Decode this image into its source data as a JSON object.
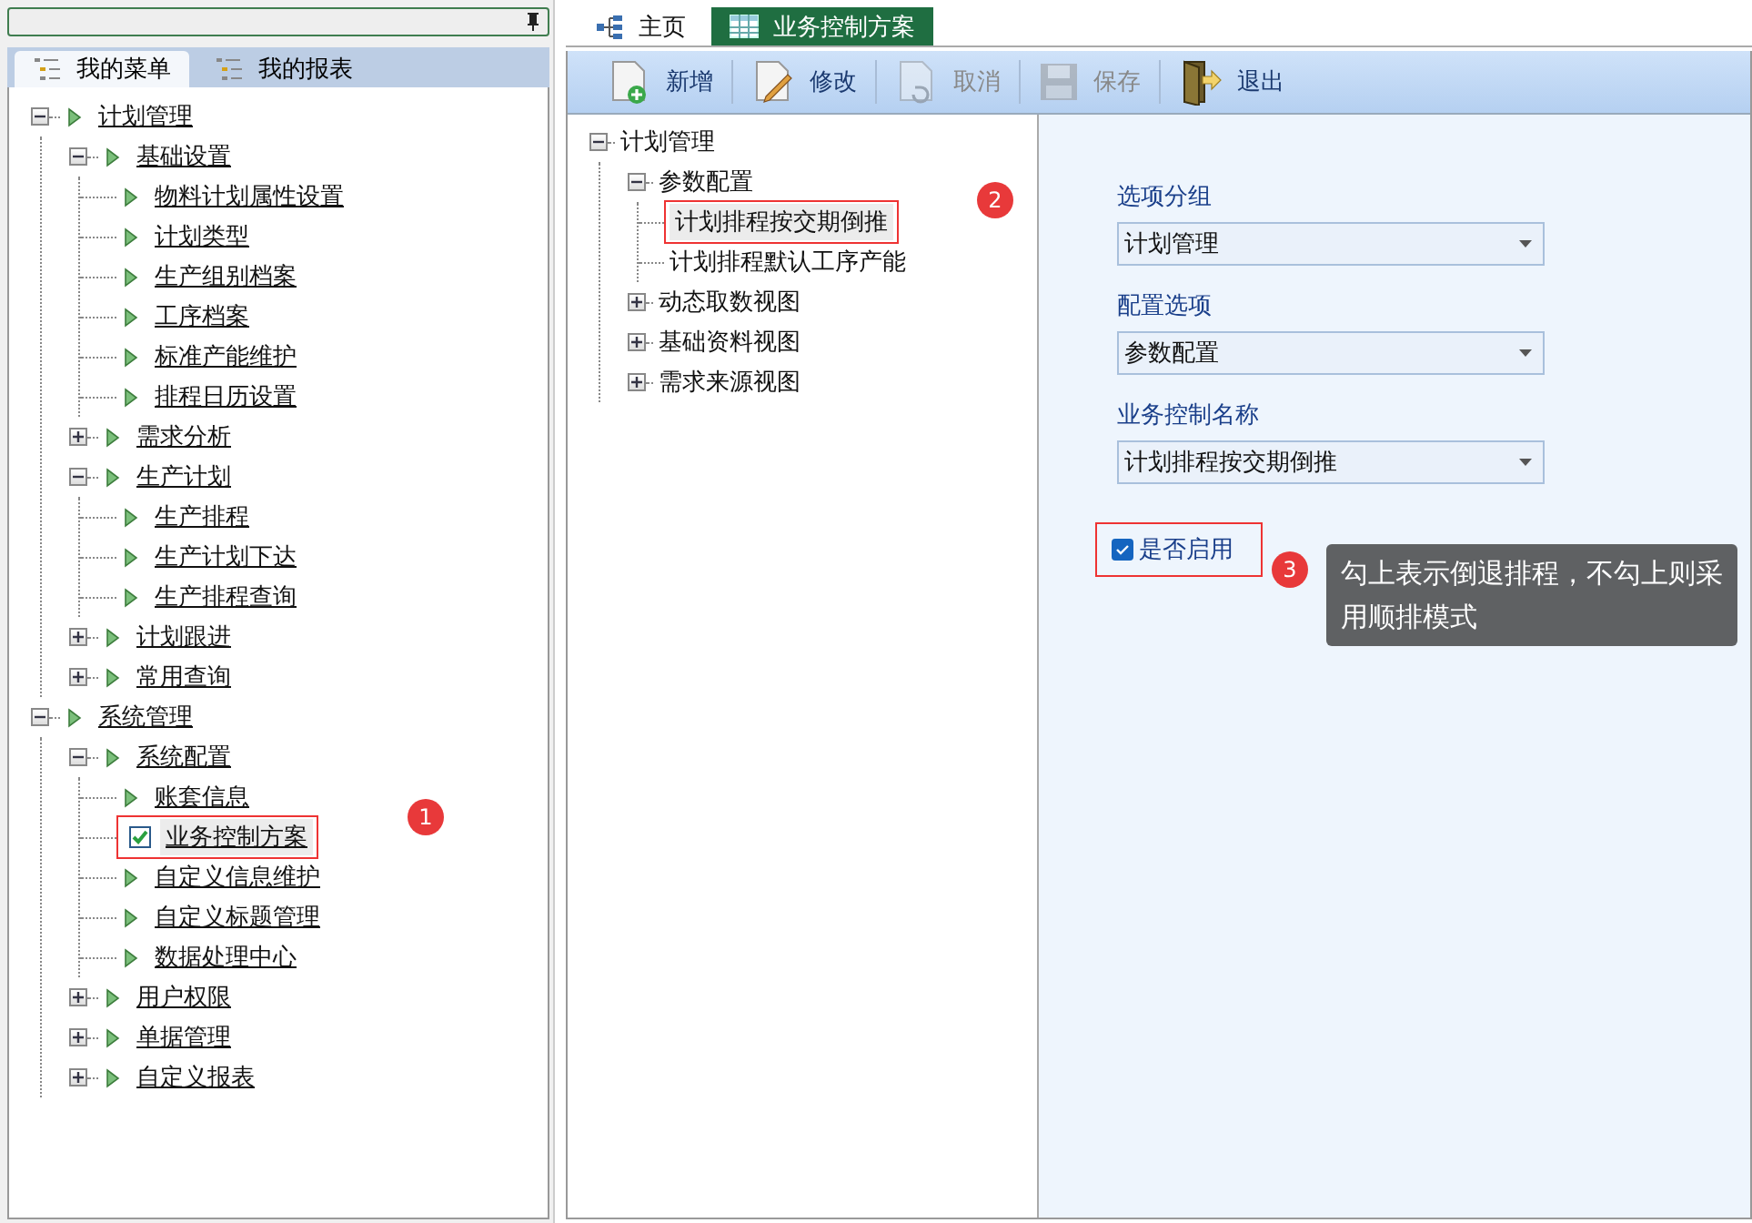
{
  "left_panel": {
    "menu_tabs": [
      {
        "label": "我的菜单",
        "selected": true
      },
      {
        "label": "我的报表",
        "selected": false
      }
    ],
    "menu_tree": [
      {
        "label": "计划管理",
        "expanded": true,
        "selected": false,
        "children": [
          {
            "label": "基础设置",
            "expanded": true,
            "selected": false,
            "children": [
              {
                "label": "物料计划属性设置",
                "selected": false
              },
              {
                "label": "计划类型",
                "selected": false
              },
              {
                "label": "生产组别档案",
                "selected": false
              },
              {
                "label": "工序档案",
                "selected": false
              },
              {
                "label": "标准产能维护",
                "selected": false
              },
              {
                "label": "排程日历设置",
                "selected": false
              }
            ]
          },
          {
            "label": "需求分析",
            "expanded": false,
            "selected": false
          },
          {
            "label": "生产计划",
            "expanded": true,
            "selected": false,
            "children": [
              {
                "label": "生产排程",
                "selected": false
              },
              {
                "label": "生产计划下达",
                "selected": false
              },
              {
                "label": "生产排程查询",
                "selected": false
              }
            ]
          },
          {
            "label": "计划跟进",
            "expanded": false,
            "selected": false
          },
          {
            "label": "常用查询",
            "expanded": false,
            "selected": false
          }
        ]
      },
      {
        "label": "系统管理",
        "expanded": true,
        "selected": false,
        "children": [
          {
            "label": "系统配置",
            "expanded": true,
            "selected": false,
            "children": [
              {
                "label": "账套信息",
                "selected": false
              },
              {
                "label": "业务控制方案",
                "selected": true,
                "callout": "1"
              },
              {
                "label": "自定义信息维护",
                "selected": false
              },
              {
                "label": "自定义标题管理",
                "selected": false
              },
              {
                "label": "数据处理中心",
                "selected": false
              }
            ]
          },
          {
            "label": "用户权限",
            "expanded": false,
            "selected": false
          },
          {
            "label": "单据管理",
            "expanded": false,
            "selected": false
          },
          {
            "label": "自定义报表",
            "expanded": false,
            "selected": false
          }
        ]
      }
    ]
  },
  "doc_tabs": [
    {
      "label": "主页",
      "selected": false,
      "kind": "home"
    },
    {
      "label": "业务控制方案",
      "selected": true,
      "kind": "grid"
    }
  ],
  "toolbar": [
    {
      "label": "新增",
      "disabled": false,
      "kind": "new"
    },
    {
      "label": "修改",
      "disabled": false,
      "kind": "edit"
    },
    {
      "label": "取消",
      "disabled": true,
      "kind": "cancel"
    },
    {
      "label": "保存",
      "disabled": true,
      "kind": "save"
    },
    {
      "label": "退出",
      "disabled": false,
      "kind": "exit"
    }
  ],
  "option_tree": [
    {
      "label": "计划管理",
      "expanded": true,
      "selected": false,
      "children": [
        {
          "label": "参数配置",
          "expanded": true,
          "selected": false,
          "children": [
            {
              "label": "计划排程按交期倒推",
              "selected": true,
              "callout": "2"
            },
            {
              "label": "计划排程默认工序产能",
              "selected": false
            }
          ]
        },
        {
          "label": "动态取数视图",
          "expanded": false,
          "selected": false
        },
        {
          "label": "基础资料视图",
          "expanded": false,
          "selected": false
        },
        {
          "label": "需求来源视图",
          "expanded": false,
          "selected": false
        }
      ]
    }
  ],
  "form": {
    "fields": [
      {
        "label": "选项分组",
        "value": "计划管理"
      },
      {
        "label": "配置选项",
        "value": "参数配置"
      },
      {
        "label": "业务控制名称",
        "value": "计划排程按交期倒推"
      }
    ],
    "enable": {
      "label": "是否启用",
      "checked": true,
      "callout": "3",
      "tooltip": "勾上表示倒退排程，不勾上则采用顺排模式"
    }
  }
}
